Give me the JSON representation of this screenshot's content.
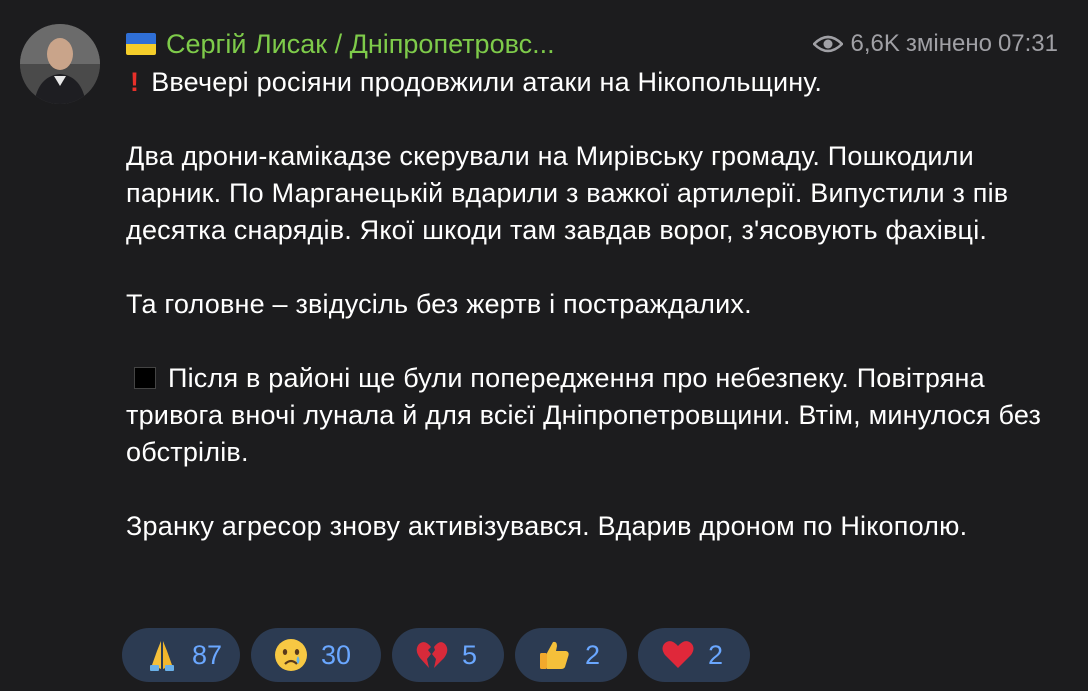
{
  "post": {
    "sender_name": "Сергій Лисак / Дніпропетровс...",
    "views": "6,6K",
    "edited_label": "змінено",
    "time": "07:31",
    "paragraphs": {
      "p1": "Ввечері росіяни продовжили атаки на Нікопольщину.",
      "p2": "Два дрони-камікадзе скерували на Мирівську громаду. Пошкодили парник. По Марганецькій вдарили з важкої артилерії. Випустили з пів десятка снарядів. Якої шкоди там завдав ворог, з'ясовують фахівці.",
      "p3": "Та головне – звідусіль без жертв і постраждалих.",
      "p4": "Після в районі ще були попередження про небезпеку. Повітряна тривога вночі лунала й для всієї Дніпропетровщини. Втім, минулося без обстрілів.",
      "p5": "Зранку агресор знову активізувався. Вдарив дроном по Нікополю."
    }
  },
  "reactions": [
    {
      "emoji": "praying-hands",
      "count": "87"
    },
    {
      "emoji": "crying-face",
      "count": "30"
    },
    {
      "emoji": "broken-heart",
      "count": "5"
    },
    {
      "emoji": "thumbs-up",
      "count": "2"
    },
    {
      "emoji": "red-heart",
      "count": "2"
    }
  ],
  "colors": {
    "background": "#1c1c1e",
    "sender": "#7ecb4a",
    "meta": "#a0a0a5",
    "reaction_bg": "#2c3b52",
    "reaction_count": "#6aa7ff"
  }
}
